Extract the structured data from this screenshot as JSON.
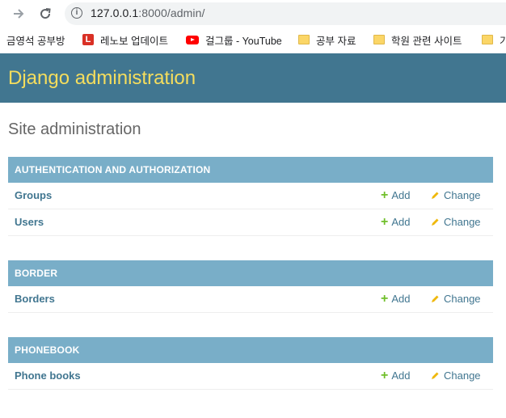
{
  "browser": {
    "url_host": "127.0.0.1",
    "url_rest": ":8000/admin/",
    "bookmarks": [
      {
        "label": "금영석 공부방",
        "icon": "none"
      },
      {
        "label": "레노보 업데이트",
        "icon": "lenovo-icon"
      },
      {
        "label": "걸그룹 - YouTube",
        "icon": "youtube-icon"
      },
      {
        "label": "공부 자료",
        "icon": "folder-icon"
      },
      {
        "label": "학원 관련 사이트",
        "icon": "folder-icon"
      },
      {
        "label": "기",
        "icon": "folder-icon"
      }
    ]
  },
  "header": {
    "title": "Django administration"
  },
  "page_title": "Site administration",
  "modules": [
    {
      "caption": "AUTHENTICATION AND AUTHORIZATION",
      "rows": [
        {
          "name": "Groups",
          "add": "Add",
          "change": "Change"
        },
        {
          "name": "Users",
          "add": "Add",
          "change": "Change"
        }
      ]
    },
    {
      "caption": "BORDER",
      "rows": [
        {
          "name": "Borders",
          "add": "Add",
          "change": "Change"
        }
      ]
    },
    {
      "caption": "PHONEBOOK",
      "rows": [
        {
          "name": "Phone books",
          "add": "Add",
          "change": "Change"
        }
      ]
    }
  ],
  "colors": {
    "header_bg": "#417690",
    "title_yellow": "#f5dd5d",
    "caption_bg": "#79aec8",
    "link": "#417690",
    "add_green": "#70bf2b",
    "change_yellow": "#efb80b"
  }
}
